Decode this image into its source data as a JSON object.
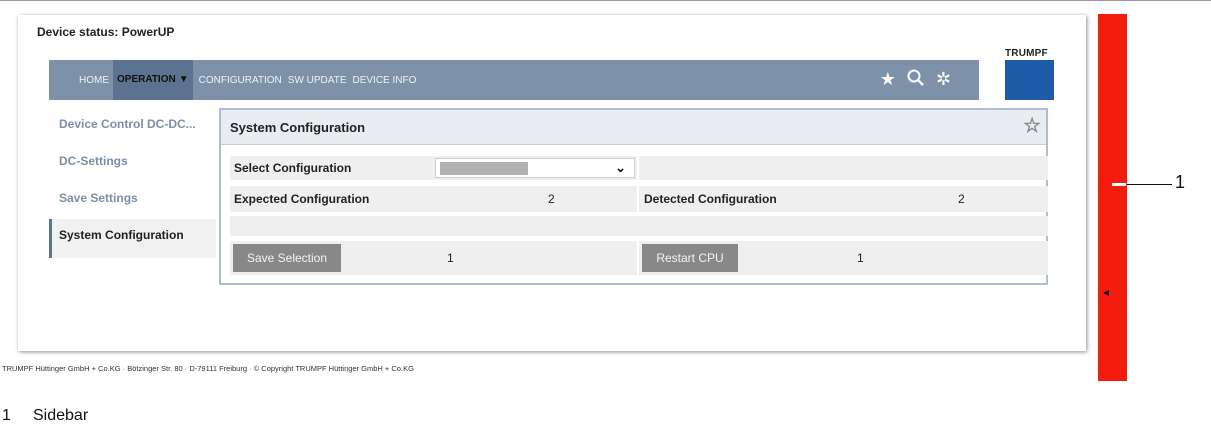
{
  "header": {
    "device_status": "Device status: PowerUP",
    "logo": "TRUMPF"
  },
  "nav": {
    "home": "HOME",
    "operation": "OPERATION",
    "operation_caret": "▼",
    "configuration": "CONFIGURATION",
    "sw_update": "SW UPDATE",
    "device_info": "DEVICE INFO",
    "icons": {
      "star": "★",
      "search": "⚲",
      "settings": "✲"
    }
  },
  "sidebar_menu": {
    "items": [
      {
        "label": "Device Control DC-DC..."
      },
      {
        "label": "DC-Settings"
      },
      {
        "label": "Save Settings"
      },
      {
        "label": "System Configuration",
        "active": true
      }
    ]
  },
  "panel": {
    "title": "System Configuration",
    "star_icon": "☆",
    "select_label": "Select Configuration",
    "select_chevron": "⌄",
    "expected_label": "Expected Configuration",
    "expected_value": "2",
    "detected_label": "Detected Configuration",
    "detected_value": "2",
    "save_button": "Save Selection",
    "save_value": "1",
    "restart_button": "Restart CPU",
    "restart_value": "1"
  },
  "footer": "TRUMPF Hüttinger GmbH + Co.KG · Bötzinger Str. 80 · D-79111 Freiburg · © Copyright TRUMPF Hüttinger GmbH + Co.KG",
  "right_sidebar": {
    "collapse_icon": "◂",
    "color": "#f41d0d"
  },
  "annotation": {
    "callout": "1",
    "legend_number": "1",
    "legend_text": "Sidebar"
  }
}
